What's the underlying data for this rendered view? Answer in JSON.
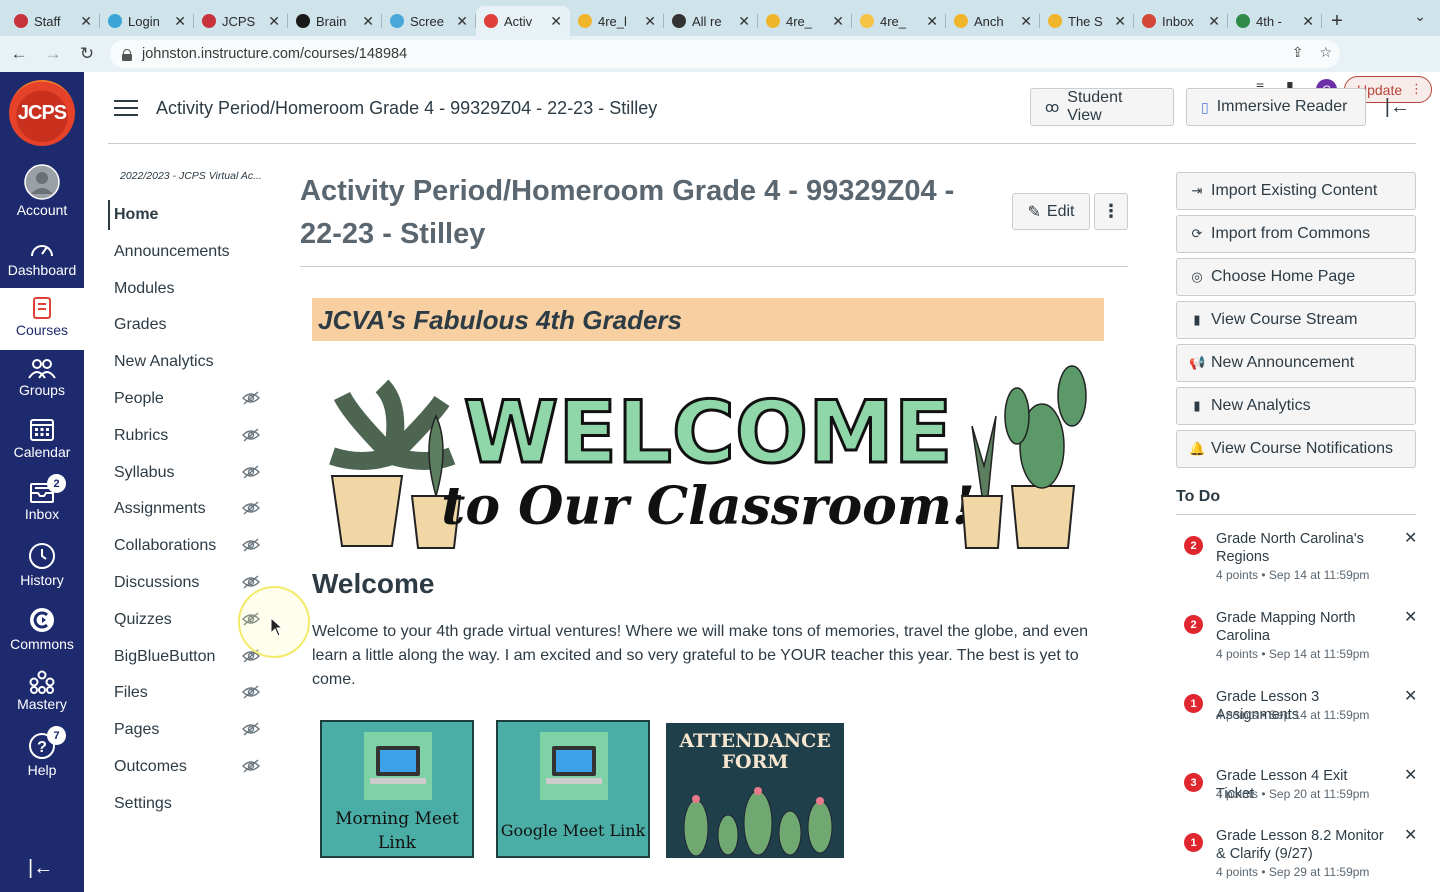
{
  "browser": {
    "tabs": [
      {
        "label": "Staff",
        "color": "#c8323a"
      },
      {
        "label": "Login",
        "color": "#3aa4d6"
      },
      {
        "label": "JCPS",
        "color": "#c8323a"
      },
      {
        "label": "Brain",
        "color": "#1a1a1a"
      },
      {
        "label": "Scree",
        "color": "#4aa7d9"
      },
      {
        "label": "Activ",
        "color": "#e0403a",
        "active": true
      },
      {
        "label": "4re_l",
        "color": "#f1b52c"
      },
      {
        "label": "All re",
        "color": "#333333"
      },
      {
        "label": "4re_",
        "color": "#f1b52c"
      },
      {
        "label": "4re_",
        "color": "#f6c344"
      },
      {
        "label": "Anch",
        "color": "#f1b52c"
      },
      {
        "label": "The S",
        "color": "#f1b52c"
      },
      {
        "label": "Inbox",
        "color": "#d44638"
      },
      {
        "label": "4th -",
        "color": "#2f8a4a"
      }
    ],
    "close_glyph": "✕",
    "url": "johnston.instructure.com/courses/148984",
    "update_label": "Update",
    "profile_initial": "C"
  },
  "global_nav": {
    "items": [
      {
        "label": "Account",
        "icon": "avatar-icon"
      },
      {
        "label": "Dashboard",
        "icon": "dashboard-icon"
      },
      {
        "label": "Courses",
        "icon": "courses-icon",
        "active": true
      },
      {
        "label": "Groups",
        "icon": "groups-icon"
      },
      {
        "label": "Calendar",
        "icon": "calendar-icon"
      },
      {
        "label": "Inbox",
        "icon": "inbox-icon",
        "badge": "2"
      },
      {
        "label": "History",
        "icon": "history-icon"
      },
      {
        "label": "Commons",
        "icon": "commons-icon"
      },
      {
        "label": "Mastery",
        "icon": "mastery-icon"
      },
      {
        "label": "Help",
        "icon": "help-icon",
        "badge": "7"
      }
    ],
    "logo_text": "JCPS"
  },
  "header": {
    "breadcrumb": "Activity Period/Homeroom Grade 4 - 99329Z04 - 22-23 - Stilley",
    "student_view": "Student View",
    "immersive_reader": "Immersive Reader"
  },
  "course_nav": {
    "term": "2022/2023 - JCPS Virtual Ac...",
    "items": [
      {
        "label": "Home",
        "active": true,
        "hidden": false
      },
      {
        "label": "Announcements",
        "hidden": false
      },
      {
        "label": "Modules",
        "hidden": false
      },
      {
        "label": "Grades",
        "hidden": false
      },
      {
        "label": "New Analytics",
        "hidden": false
      },
      {
        "label": "People",
        "hidden": true
      },
      {
        "label": "Rubrics",
        "hidden": true
      },
      {
        "label": "Syllabus",
        "hidden": true
      },
      {
        "label": "Assignments",
        "hidden": true
      },
      {
        "label": "Collaborations",
        "hidden": true
      },
      {
        "label": "Discussions",
        "hidden": true
      },
      {
        "label": "Quizzes",
        "hidden": true
      },
      {
        "label": "BigBlueButton",
        "hidden": true
      },
      {
        "label": "Files",
        "hidden": true
      },
      {
        "label": "Pages",
        "hidden": true
      },
      {
        "label": "Outcomes",
        "hidden": true
      },
      {
        "label": "Settings",
        "hidden": false
      }
    ]
  },
  "main": {
    "title": "Activity Period/Homeroom Grade 4 - 99329Z04 - 22-23 - Stilley",
    "edit_label": "Edit",
    "banner": "JCVA's Fabulous 4th Graders",
    "welcome_big": "WELCOME",
    "welcome_script": "to Our Classroom!",
    "heading": "Welcome",
    "paragraph": "Welcome to your 4th grade virtual ventures! Where we will make tons of memories, travel the globe, and even learn a little along the way. I am excited and so very grateful to be YOUR teacher this year. The best is yet to come.",
    "tiles": [
      {
        "label": "Morning Meet Link"
      },
      {
        "label": "Google Meet Link"
      },
      {
        "label": "ATTENDANCE FORM"
      }
    ]
  },
  "sidebar": {
    "buttons": [
      {
        "label": "Import Existing Content",
        "icon": "import-icon"
      },
      {
        "label": "Import from Commons",
        "icon": "commons-icon"
      },
      {
        "label": "Choose Home Page",
        "icon": "target-icon"
      },
      {
        "label": "View Course Stream",
        "icon": "bar-chart-icon"
      },
      {
        "label": "New Announcement",
        "icon": "megaphone-icon"
      },
      {
        "label": "New Analytics",
        "icon": "bar-chart-icon"
      },
      {
        "label": "View Course Notifications",
        "icon": "bell-icon"
      }
    ],
    "todo_heading": "To Do",
    "todos": [
      {
        "count": "2",
        "title": "Grade North Carolina's Regions",
        "meta": "4 points • Sep 14 at 11:59pm"
      },
      {
        "count": "2",
        "title": "Grade Mapping North Carolina",
        "meta": "4 points • Sep 14 at 11:59pm"
      },
      {
        "count": "1",
        "title": "Grade Lesson 3 Assignments",
        "meta": "4 points • Sep 14 at 11:59pm"
      },
      {
        "count": "3",
        "title": "Grade Lesson 4 Exit Ticket",
        "meta": "4 points • Sep 20 at 11:59pm"
      },
      {
        "count": "1",
        "title": "Grade Lesson 8.2 Monitor & Clarify (9/27)",
        "meta": "4 points • Sep 29 at 11:59pm"
      }
    ]
  }
}
